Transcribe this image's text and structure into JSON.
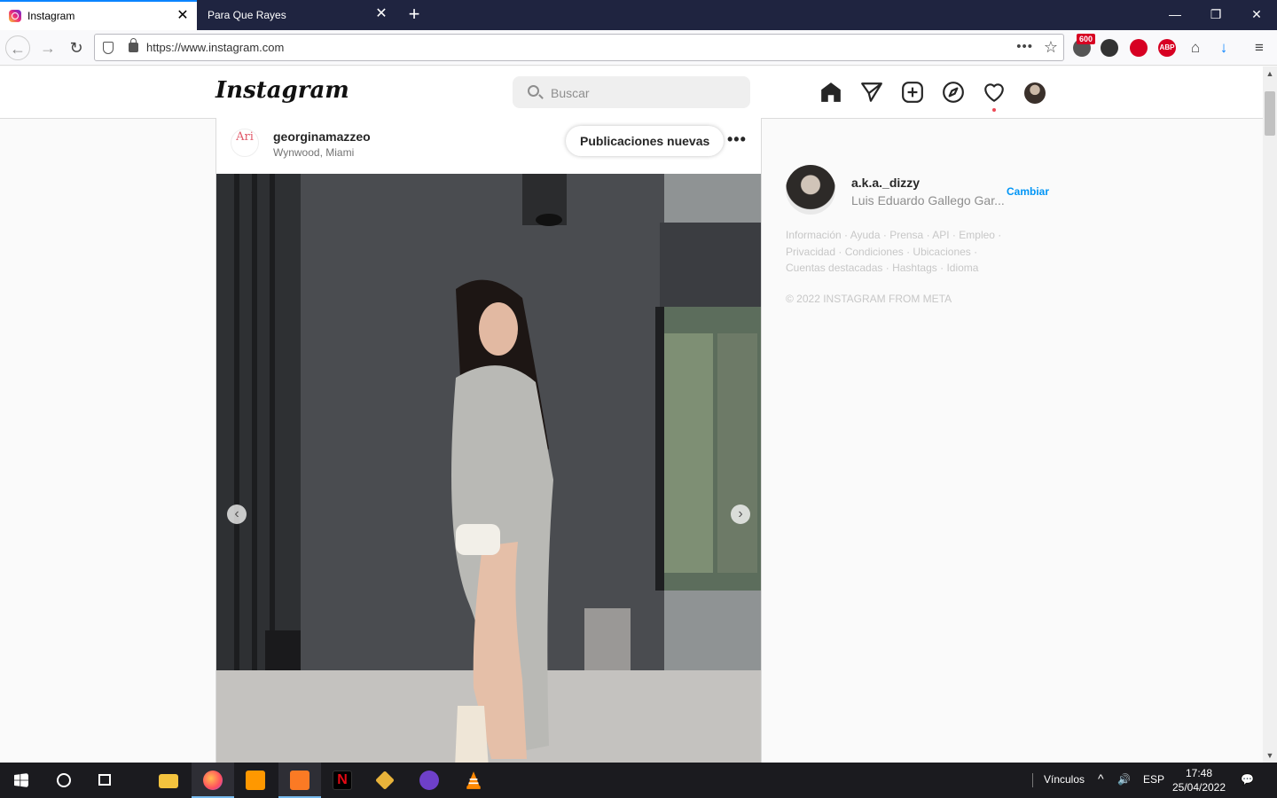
{
  "browser": {
    "tabs": [
      {
        "label": "Instagram",
        "active": true
      },
      {
        "label": "Para Que Rayes",
        "active": false
      }
    ],
    "new_tab_symbol": "+",
    "close_symbol": "✕",
    "window_controls": {
      "minimize": "—",
      "restore": "❐",
      "close": "✕"
    },
    "url": "https://www.instagram.com",
    "url_menu": "•••",
    "bookmark_symbol": "☆",
    "extension_badge": "600",
    "extensions": [
      {
        "name": "ublock-icon",
        "label": "",
        "color": "#555555"
      },
      {
        "name": "translate-icon",
        "label": "",
        "color": "#333333"
      },
      {
        "name": "opera-adblock-icon",
        "label": "",
        "color": "#d70022"
      },
      {
        "name": "abp-icon",
        "label": "ABP",
        "color": "#d70022"
      },
      {
        "name": "home-icon",
        "label": "⌂",
        "color": "#444444"
      },
      {
        "name": "download-icon",
        "label": "↓",
        "color": "#0a84ff"
      },
      {
        "name": "menu-icon",
        "label": "≡",
        "color": "#444444"
      }
    ]
  },
  "instagram": {
    "logo": "Instagram",
    "search_placeholder": "Buscar",
    "post": {
      "avatar_text": "Ari",
      "username": "georginamazzeo",
      "location": "Wynwood, Miami",
      "new_posts_label": "Publicaciones nuevas",
      "more_label": "•••",
      "prev_label": "‹",
      "next_label": "›"
    },
    "sidebar": {
      "username": "a.k.a._dizzy",
      "full_name": "Luis Eduardo Gallego Gar...",
      "switch_label": "Cambiar",
      "footer_links": [
        "Información",
        "Ayuda",
        "Prensa",
        "API",
        "Empleo",
        "Privacidad",
        "Condiciones",
        "Ubicaciones",
        "Cuentas destacadas",
        "Hashtags",
        "Idioma"
      ],
      "copyright": "© 2022 INSTAGRAM FROM META"
    }
  },
  "taskbar": {
    "links_label": "Vínculos",
    "language": "ESP",
    "time": "17:48",
    "date": "25/04/2022",
    "up_arrow": "^",
    "volume": "🔊",
    "notifications": "💬"
  },
  "colors": {
    "accent_blue": "#0095f6",
    "tab_strip": "#1f2440",
    "notification_red": "#ed4956"
  }
}
